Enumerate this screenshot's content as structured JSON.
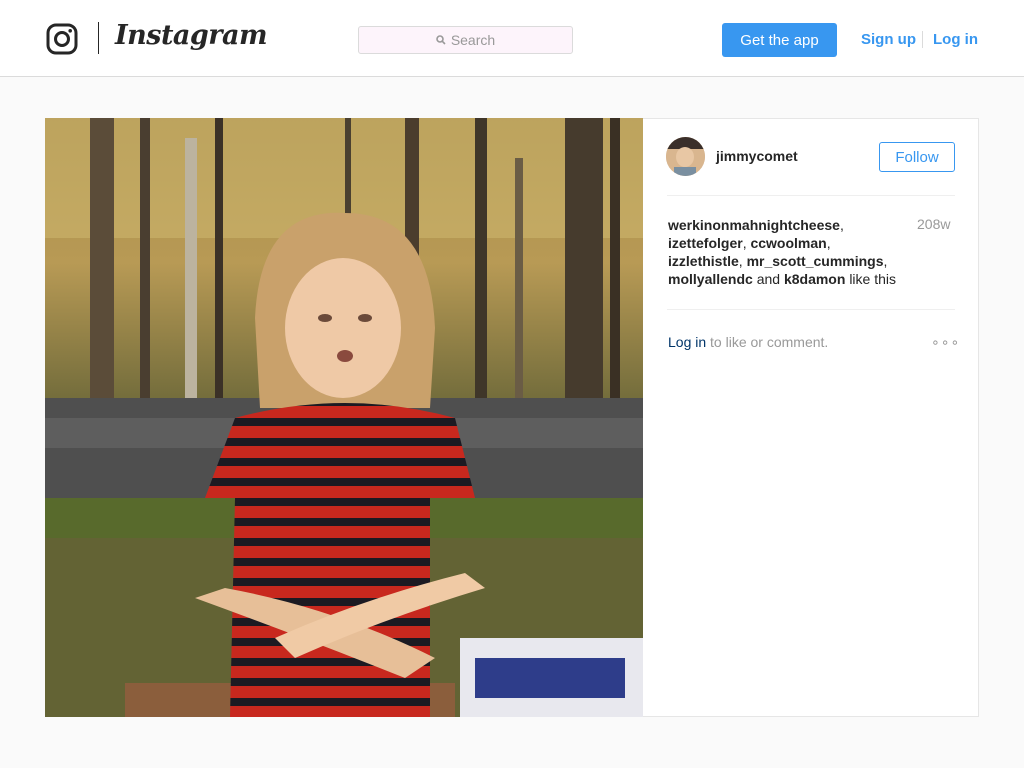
{
  "nav": {
    "brand": "Instagram",
    "search_placeholder": "Search",
    "get_app_label": "Get the app",
    "signup_label": "Sign up",
    "login_label": "Log in",
    "accent_color": "#3897f0"
  },
  "post": {
    "author": "jimmycomet",
    "follow_label": "Follow",
    "age": "208w",
    "likers": [
      "werkinonmahnightcheese",
      "izettefolger",
      "ccwoolman",
      "izzlethistle",
      "mr_scott_cummings",
      "mollyallendc"
    ],
    "last_liker": "k8damon",
    "and_word": "and",
    "likes_suffix": "like this",
    "login_prompt_link": "Log in",
    "login_prompt_text": "to like or comment.",
    "more_glyph": "∘∘∘"
  },
  "icons": [
    "instagram-glyph-icon",
    "search-icon",
    "more-options-icon"
  ]
}
